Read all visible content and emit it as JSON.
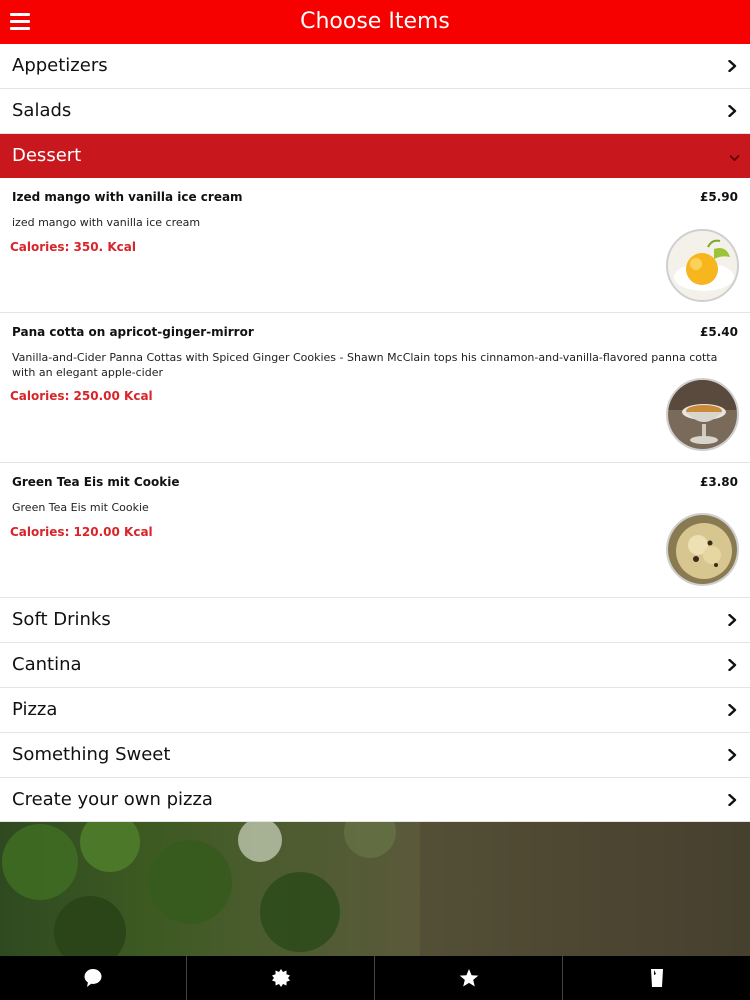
{
  "header": {
    "title": "Choose Items"
  },
  "categories_top": [
    {
      "label": "Appetizers"
    },
    {
      "label": "Salads"
    }
  ],
  "open_category": {
    "label": "Dessert"
  },
  "items": [
    {
      "name": "Ized mango with vanilla ice cream",
      "price": "£5.90",
      "description": "ized mango with vanilla ice cream",
      "calories": "Calories: 350. Kcal"
    },
    {
      "name": "Pana cotta on apricot-ginger-mirror",
      "price": "£5.40",
      "description": "Vanilla-and-Cider Panna Cottas with Spiced Ginger Cookies - Shawn McClain tops his cinnamon-and-vanilla-flavored panna cotta with an elegant apple-cider",
      "calories": "Calories: 250.00 Kcal"
    },
    {
      "name": "Green Tea Eis mit Cookie",
      "price": "£3.80",
      "description": "Green Tea Eis mit Cookie",
      "calories": "Calories: 120.00 Kcal"
    }
  ],
  "categories_bottom": [
    {
      "label": "Soft Drinks"
    },
    {
      "label": "Cantina"
    },
    {
      "label": "Pizza"
    },
    {
      "label": "Something Sweet"
    },
    {
      "label": "Create your own pizza"
    }
  ],
  "tabbar": {
    "tabs": [
      {
        "icon": "chat-bubble-icon"
      },
      {
        "icon": "badge-icon"
      },
      {
        "icon": "star-icon"
      },
      {
        "icon": "drink-icon"
      }
    ]
  },
  "colors": {
    "header_bg": "#f70000",
    "open_category_bg": "#c8171d",
    "calories_text": "#d8252a",
    "tabbar_bg": "#000000"
  }
}
